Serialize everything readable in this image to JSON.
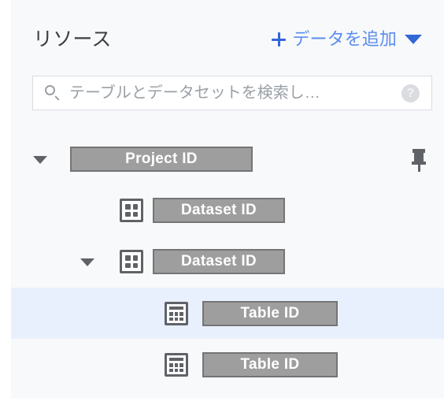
{
  "header": {
    "title": "リソース",
    "add_data_label": "データを追加",
    "plus_icon": "plus-icon",
    "caret_icon": "chevron-down-icon"
  },
  "search": {
    "value": "",
    "placeholder": "テーブルとデータセットを検索し…",
    "search_icon": "search-icon",
    "help_icon": "help-circle-icon",
    "help_glyph": "?"
  },
  "colors": {
    "panel_background": "#F8F9FA",
    "accent_blue": "#3367D6",
    "link_blue": "#5B8DEF",
    "selected_row": "#E8F0FE",
    "redaction_fill": "#9E9E9E",
    "redaction_border": "#757575",
    "icon_gray": "#5F6368",
    "placeholder_gray": "#9AA0A6",
    "field_border": "#DADCE0"
  },
  "tree": {
    "rows": [
      {
        "label": "Project ID",
        "type": "project",
        "indent": 0,
        "expanded": true,
        "selected": false,
        "has_twisty": true,
        "icon": "none",
        "pinned": true,
        "pin_icon": "pin-icon"
      },
      {
        "label": "Dataset ID",
        "type": "dataset",
        "indent": 1,
        "expanded": false,
        "selected": false,
        "has_twisty": false,
        "icon": "dataset-grid-icon",
        "pinned": false
      },
      {
        "label": "Dataset ID",
        "type": "dataset",
        "indent": 1,
        "expanded": true,
        "selected": false,
        "has_twisty": true,
        "icon": "dataset-grid-icon",
        "pinned": false
      },
      {
        "label": "Table ID",
        "type": "table",
        "indent": 2,
        "expanded": false,
        "selected": true,
        "has_twisty": false,
        "icon": "table-grid-icon",
        "pinned": false
      },
      {
        "label": "Table ID",
        "type": "table",
        "indent": 2,
        "expanded": false,
        "selected": false,
        "has_twisty": false,
        "icon": "table-grid-icon",
        "pinned": false
      }
    ]
  }
}
